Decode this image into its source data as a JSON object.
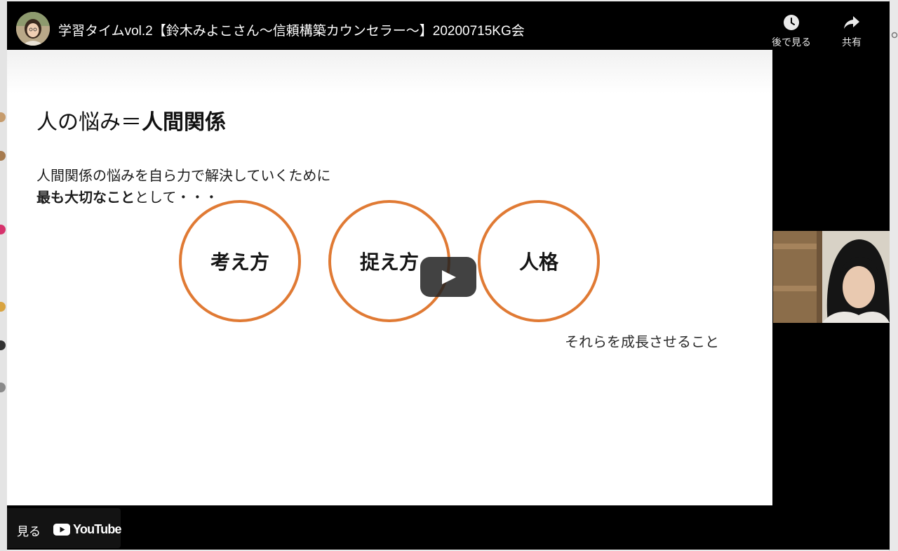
{
  "player": {
    "title": "学習タイムvol.2【鈴木みよこさん〜信頼構築カウンセラー〜】20200715KG会",
    "watch_later_label": "後で見る",
    "share_label": "共有",
    "watch_on_label": "見る",
    "youtube_wordmark": "YouTube",
    "accent_color": "#ff0000"
  },
  "slide": {
    "heading_plain": "人の悩み＝",
    "heading_bold": "人間関係",
    "line1": "人間関係の悩みを自ら力で解決していくために",
    "line2_bold": "最も大切なこと",
    "line2_rest": "として・・・",
    "circles": [
      "考え方",
      "捉え方",
      "人格"
    ],
    "circle_color": "#e07a34",
    "footer": "それらを成長させること"
  }
}
